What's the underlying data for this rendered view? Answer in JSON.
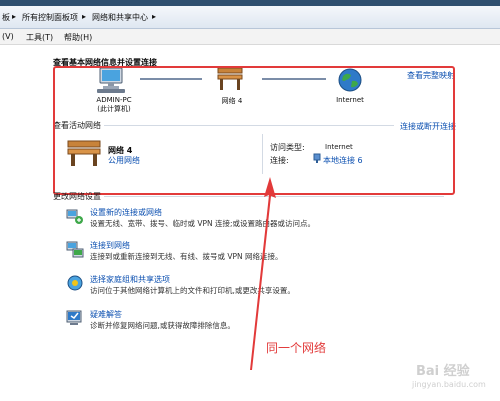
{
  "breadcrumb": {
    "items": [
      "板",
      "所有控制面板项",
      "网络和共享中心"
    ],
    "separator": "▸"
  },
  "menu": {
    "items": [
      "(V)",
      "工具(T)",
      "帮助(H)"
    ]
  },
  "network_map": {
    "title": "查看基本网络信息并设置连接",
    "full_map_link": "查看完整映射",
    "computer_name": "ADMIN-PC",
    "computer_sub": "(此计算机)",
    "network_name": "网络  4",
    "internet_label": "Internet"
  },
  "active_networks": {
    "title": "查看活动网络",
    "connect_link": "连接或断开连接",
    "network_name": "网络  4",
    "network_type": "公用网络",
    "access_type_label": "访问类型:",
    "access_type_value": "Internet",
    "connection_label": "连接:",
    "connection_value": "本地连接 6"
  },
  "settings": {
    "title": "更改网络设置",
    "items": [
      {
        "icon": "new-connection-icon",
        "title": "设置新的连接或网络",
        "desc": "设置无线、宽带、拨号、临时或 VPN 连接;或设置路由器或访问点。"
      },
      {
        "icon": "connect-network-icon",
        "title": "连接到网络",
        "desc": "连接到或重新连接到无线、有线、拨号或 VPN 网络连接。"
      },
      {
        "icon": "homegroup-icon",
        "title": "选择家庭组和共享选项",
        "desc": "访问位于其他网络计算机上的文件和打印机,或更改共享设置。"
      },
      {
        "icon": "troubleshoot-icon",
        "title": "疑难解答",
        "desc": "诊断并修复网络问题,或获得故障排除信息。"
      }
    ]
  },
  "annotation": {
    "text": "同一个网络",
    "color": "#e23a3a"
  },
  "watermark": {
    "text": "Bai 经验",
    "url": "jingyan.baidu.com"
  }
}
